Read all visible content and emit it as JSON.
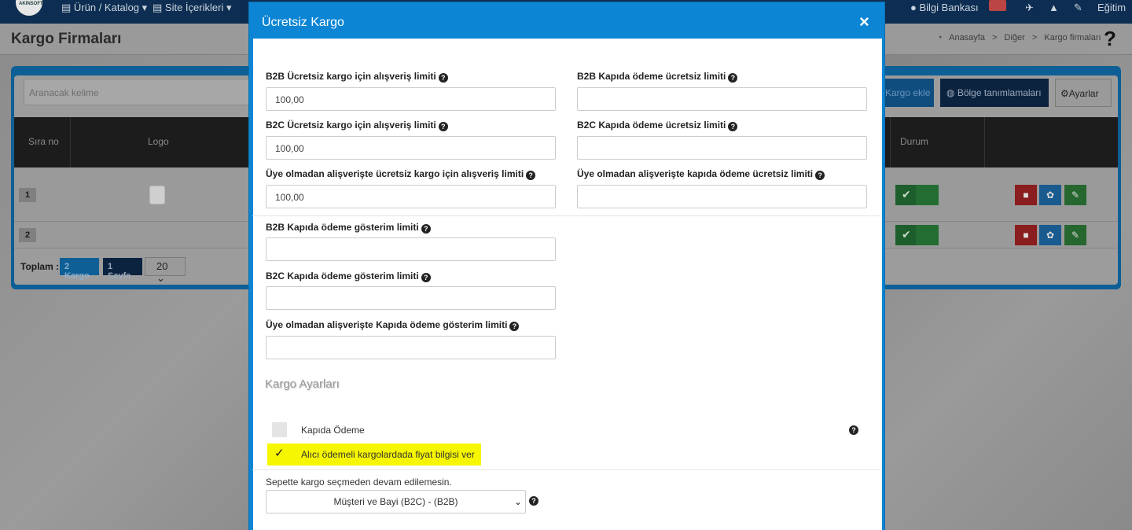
{
  "app": {
    "nav": {
      "logo_text": "AKINSOFT",
      "items": [
        "Ürün / Katalog",
        "Site İçerikleri"
      ],
      "right": {
        "bilgi_bankasi": "Bilgi Bankası",
        "egitim": "Eğitim"
      }
    },
    "page": {
      "title": "Kargo Firmaları",
      "breadcrumb": [
        "Anasayfa",
        "Diğer",
        "Kargo firmaları"
      ],
      "help": "?"
    },
    "toolbar": {
      "search_placeholder": "Aranacak kelime",
      "add_label": "Kargo ekle",
      "region_label": "Bölge tanımlamaları",
      "settings_label": "Ayarlar"
    },
    "table": {
      "headers": [
        "Sıra no",
        "Logo",
        "Durum"
      ],
      "rows": [
        {
          "num": "1"
        },
        {
          "num": "2"
        }
      ]
    },
    "footer": {
      "total_label": "Toplam :",
      "cargo_count": "2 Kargo",
      "page_count": "1 Sayfa",
      "per_page": "20"
    }
  },
  "modal": {
    "title": "Ücretsiz Kargo",
    "close": "×",
    "fields": {
      "b2b_free_limit": {
        "label": "B2B Ücretsiz kargo için alışveriş limiti",
        "value": "100,00"
      },
      "b2b_cod_free": {
        "label": "B2B Kapıda ödeme ücretsiz limiti",
        "value": ""
      },
      "b2c_free_limit": {
        "label": "B2C Ücretsiz kargo için alışveriş limiti",
        "value": "100,00"
      },
      "b2c_cod_free": {
        "label": "B2C Kapıda ödeme ücretsiz limiti",
        "value": ""
      },
      "guest_free_limit": {
        "label": "Üye olmadan alişverişte ücretsiz kargo için alışveriş limiti",
        "value": "100,00"
      },
      "guest_cod_free": {
        "label": "Üye olmadan alişverişte kapıda ödeme ücretsiz limiti",
        "value": ""
      },
      "b2b_cod_show": {
        "label": "B2B Kapıda ödeme gösterim limiti",
        "value": ""
      },
      "b2c_cod_show": {
        "label": "B2C Kapıda ödeme gösterim limiti",
        "value": ""
      },
      "guest_cod_show": {
        "label": "Üye olmadan alişverişte Kapıda ödeme gösterim limiti",
        "value": ""
      }
    },
    "section_title": "Kargo Ayarları",
    "options": {
      "cod": {
        "label": "Kapıda Ödeme",
        "checked": false
      },
      "receiver_pays": {
        "label": "Alıcı ödemeli kargolardada fiyat bilgisi ver",
        "checked": true
      }
    },
    "cart_continue": {
      "label": "Sepette kargo seçmeden devam edilemesin.",
      "selected": "Müşteri ve Bayi (B2C) - (B2B)"
    },
    "colors": {
      "header": "#0b85d4",
      "highlight": "#f6f600"
    }
  }
}
